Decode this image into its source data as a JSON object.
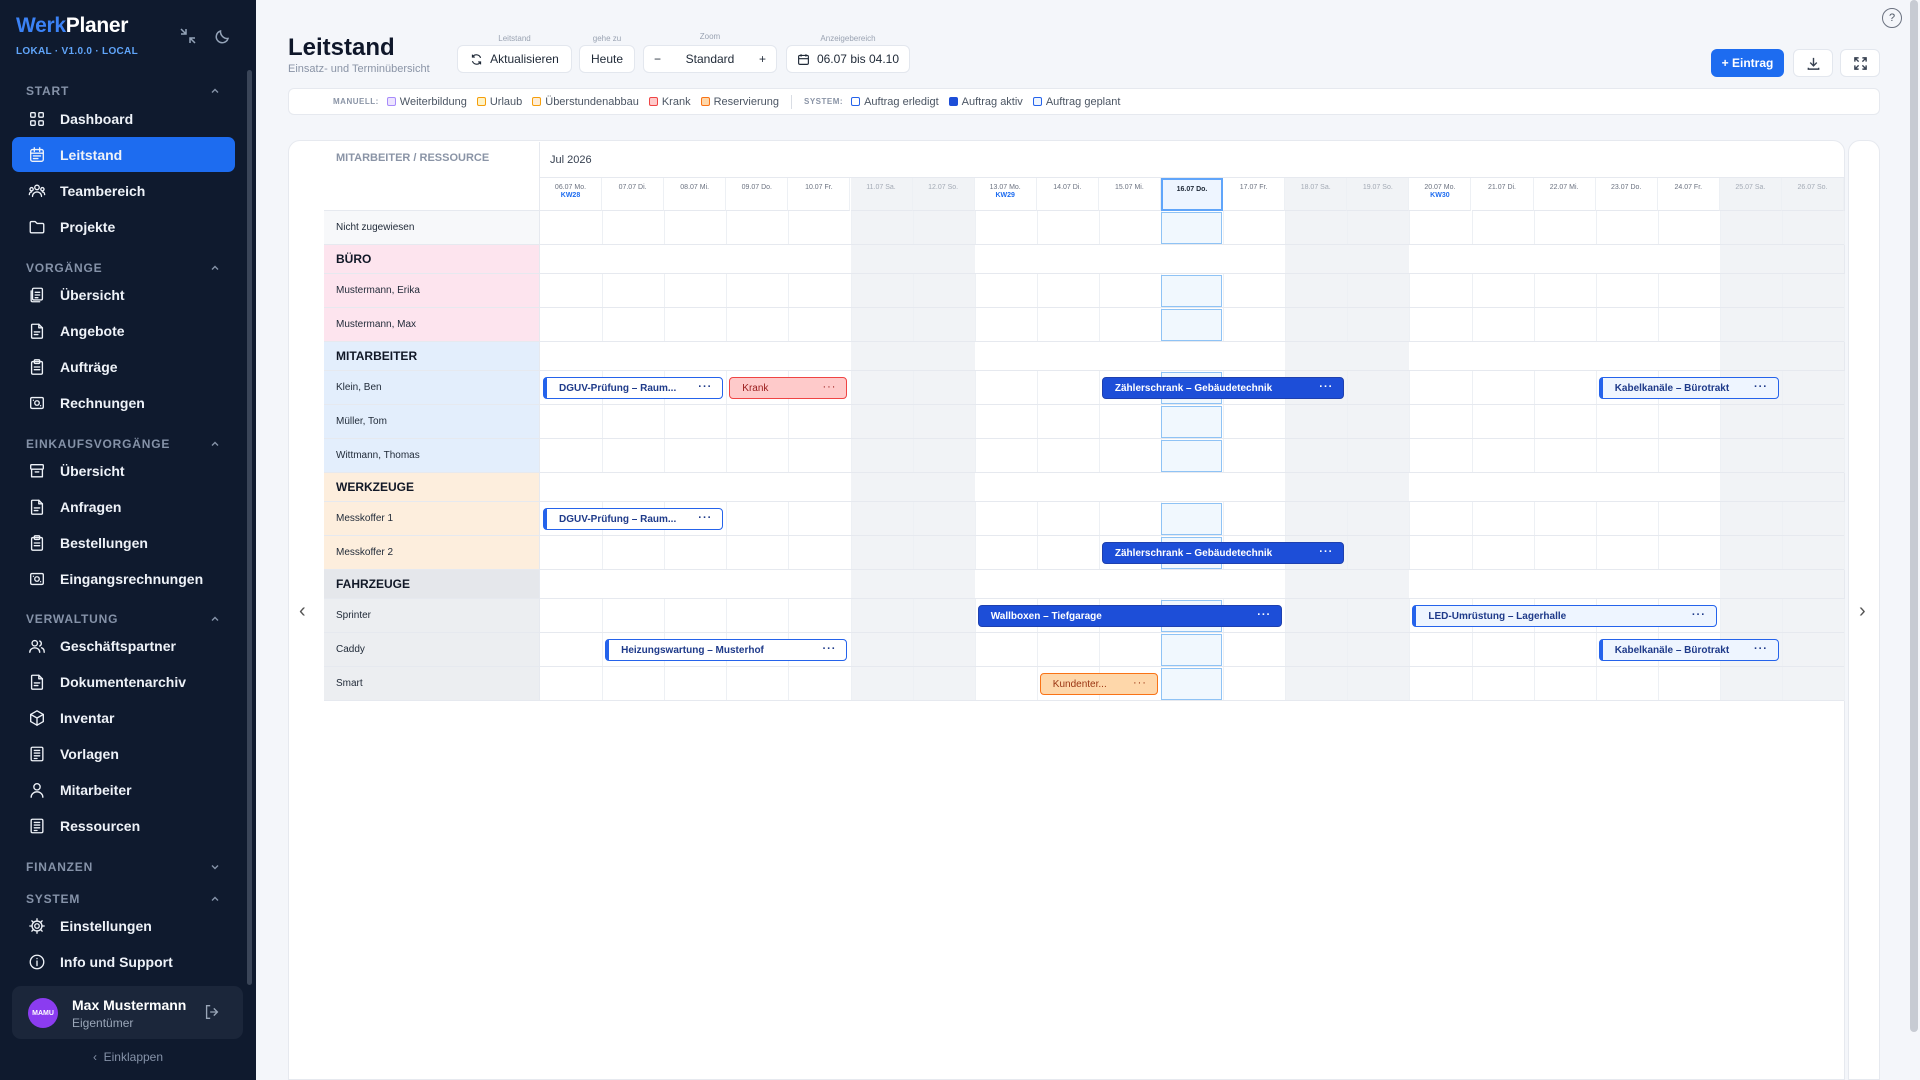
{
  "brand": {
    "part1": "Werk",
    "part2": "Planer",
    "version": "LOKAL · V1.0.0 · LOCAL"
  },
  "sidebar": {
    "sections": [
      {
        "title": "START"
      },
      {
        "title": "VORGÄNGE"
      },
      {
        "title": "EINKAUFSVORGÄNGE"
      },
      {
        "title": "VERWALTUNG"
      },
      {
        "title": "FINANZEN"
      },
      {
        "title": "SYSTEM"
      }
    ],
    "items": [
      {
        "label": "Dashboard",
        "icon": "grid-icon"
      },
      {
        "label": "Leitstand",
        "icon": "calendar-icon",
        "active": true
      },
      {
        "label": "Teambereich",
        "icon": "team-icon"
      },
      {
        "label": "Projekte",
        "icon": "folder-icon"
      },
      {
        "label": "Übersicht",
        "icon": "documents-icon"
      },
      {
        "label": "Angebote",
        "icon": "document-icon"
      },
      {
        "label": "Aufträge",
        "icon": "clipboard-icon"
      },
      {
        "label": "Rechnungen",
        "icon": "invoice-icon"
      },
      {
        "label": "Übersicht",
        "icon": "archive-icon"
      },
      {
        "label": "Anfragen",
        "icon": "document-icon"
      },
      {
        "label": "Bestellungen",
        "icon": "clipboard-icon"
      },
      {
        "label": "Eingangsrechnungen",
        "icon": "invoice-icon"
      },
      {
        "label": "Geschäftspartner",
        "icon": "users-icon"
      },
      {
        "label": "Dokumentenarchiv",
        "icon": "document-icon"
      },
      {
        "label": "Inventar",
        "icon": "box-icon"
      },
      {
        "label": "Vorlagen",
        "icon": "template-icon"
      },
      {
        "label": "Mitarbeiter",
        "icon": "user-icon"
      },
      {
        "label": "Ressourcen",
        "icon": "template-icon"
      },
      {
        "label": "Einstellungen",
        "icon": "gear-icon"
      },
      {
        "label": "Info und Support",
        "icon": "info-icon"
      }
    ],
    "user": {
      "initials": "MAMU",
      "name": "Max Mustermann",
      "role": "Eigentümer"
    },
    "collapse_label": "Einklappen"
  },
  "header": {
    "title": "Leitstand",
    "subtitle": "Einsatz- und Terminübersicht",
    "labels": {
      "leitstand": "Leitstand",
      "goto": "gehe zu",
      "zoom": "Zoom",
      "range": "Anzeigebereich"
    },
    "refresh_label": "Aktualisieren",
    "today_label": "Heute",
    "zoom_minus": "−",
    "zoom_value": "Standard",
    "zoom_plus": "+",
    "range_value": "06.07 bis 04.10",
    "new_entry_label": "+ Eintrag",
    "help_label": "?"
  },
  "legend": {
    "manual_title": "MANUELL:",
    "manual": [
      {
        "label": "Weiterbildung",
        "fill": "#ede4ff",
        "border": "#a78bfa"
      },
      {
        "label": "Urlaub",
        "fill": "#fef3c7",
        "border": "#f59e0b"
      },
      {
        "label": "Überstundenabbau",
        "fill": "#ffedd5",
        "border": "#f59e0b"
      },
      {
        "label": "Krank",
        "fill": "#fecaca",
        "border": "#ef4444"
      },
      {
        "label": "Reservierung",
        "fill": "#fed7aa",
        "border": "#f97316"
      }
    ],
    "system_title": "SYSTEM:",
    "system": [
      {
        "label": "Auftrag erledigt",
        "fill": "#ffffff",
        "border": "#2563eb"
      },
      {
        "label": "Auftrag aktiv",
        "fill": "#1d4ed8",
        "border": "#1d4ed8"
      },
      {
        "label": "Auftrag geplant",
        "fill": "#eef5ff",
        "border": "#2563eb"
      }
    ]
  },
  "grid": {
    "resource_header": "MITARBEITER / RESSOURCE",
    "month": "Jul 2026",
    "days": [
      {
        "label": "06.07 Mo.",
        "kw": "KW28"
      },
      {
        "label": "07.07 Di."
      },
      {
        "label": "08.07 Mi."
      },
      {
        "label": "09.07 Do."
      },
      {
        "label": "10.07 Fr."
      },
      {
        "label": "11.07 Sa.",
        "weekend": true
      },
      {
        "label": "12.07 So.",
        "weekend": true
      },
      {
        "label": "13.07 Mo.",
        "kw": "KW29"
      },
      {
        "label": "14.07 Di."
      },
      {
        "label": "15.07 Mi."
      },
      {
        "label": "16.07 Do.",
        "today": true
      },
      {
        "label": "17.07 Fr."
      },
      {
        "label": "18.07 Sa.",
        "weekend": true
      },
      {
        "label": "19.07 So.",
        "weekend": true
      },
      {
        "label": "20.07 Mo.",
        "kw": "KW30"
      },
      {
        "label": "21.07 Di."
      },
      {
        "label": "22.07 Mi."
      },
      {
        "label": "23.07 Do."
      },
      {
        "label": "24.07 Fr."
      },
      {
        "label": "25.07 Sa.",
        "weekend": true
      },
      {
        "label": "26.07 So.",
        "weekend": true
      }
    ],
    "rows": [
      {
        "label": "Nicht zugewiesen",
        "type": "row",
        "color": "#f7f8fa"
      },
      {
        "label": "BÜRO",
        "type": "group",
        "color": "#fde4ee"
      },
      {
        "label": "Mustermann, Erika",
        "type": "row",
        "color": "#fde4ee"
      },
      {
        "label": "Mustermann, Max",
        "type": "row",
        "color": "#fde4ee"
      },
      {
        "label": "MITARBEITER",
        "type": "group",
        "color": "#e3eefc"
      },
      {
        "label": "Klein, Ben",
        "type": "row",
        "color": "#e3eefc"
      },
      {
        "label": "Müller, Tom",
        "type": "row",
        "color": "#e3eefc"
      },
      {
        "label": "Wittmann, Thomas",
        "type": "row",
        "color": "#e3eefc"
      },
      {
        "label": "WERKZEUGE",
        "type": "group",
        "color": "#fdeedd"
      },
      {
        "label": "Messkoffer 1",
        "type": "row",
        "color": "#fdeedd"
      },
      {
        "label": "Messkoffer 2",
        "type": "row",
        "color": "#fdeedd"
      },
      {
        "label": "FAHRZEUGE",
        "type": "group",
        "color": "#e5e7eb"
      },
      {
        "label": "Sprinter",
        "type": "row",
        "color": "#eceef1"
      },
      {
        "label": "Caddy",
        "type": "row",
        "color": "#eceef1"
      },
      {
        "label": "Smart",
        "type": "row",
        "color": "#eceef1"
      }
    ],
    "events": [
      {
        "row": 5,
        "start": 0,
        "days": 3,
        "label": "DGUV-Prüfung – Raum...",
        "kind": "planned"
      },
      {
        "row": 5,
        "start": 3,
        "days": 2,
        "label": "Krank",
        "kind": "krank"
      },
      {
        "row": 5,
        "start": 9,
        "days": 4,
        "label": "Zählerschrank – Gebäudetechnik",
        "kind": "active"
      },
      {
        "row": 5,
        "start": 17,
        "days": 3,
        "label": "Kabelkanäle – Bürotrakt",
        "kind": "planned-light"
      },
      {
        "row": 9,
        "start": 0,
        "days": 3,
        "label": "DGUV-Prüfung – Raum...",
        "kind": "planned"
      },
      {
        "row": 10,
        "start": 9,
        "days": 4,
        "label": "Zählerschrank – Gebäudetechnik",
        "kind": "active"
      },
      {
        "row": 12,
        "start": 7,
        "days": 5,
        "label": "Wallboxen – Tiefgarage",
        "kind": "active"
      },
      {
        "row": 12,
        "start": 14,
        "days": 5,
        "label": "LED-Umrüstung – Lagerhalle",
        "kind": "planned-light"
      },
      {
        "row": 13,
        "start": 1,
        "days": 4,
        "label": "Heizungswartung – Musterhof",
        "kind": "planned"
      },
      {
        "row": 13,
        "start": 17,
        "days": 3,
        "label": "Kabelkanäle – Bürotrakt",
        "kind": "planned-light"
      },
      {
        "row": 14,
        "start": 8,
        "days": 2,
        "label": "Kundenter...",
        "kind": "reserv"
      }
    ],
    "more_label": "···",
    "prev_arrow": "‹",
    "next_arrow": "›"
  }
}
